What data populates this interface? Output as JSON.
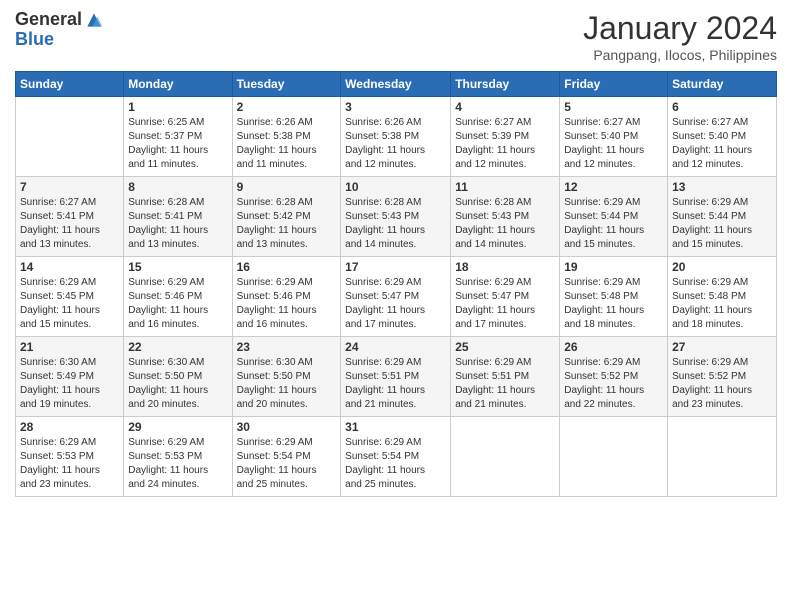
{
  "logo": {
    "general": "General",
    "blue": "Blue"
  },
  "title": "January 2024",
  "location": "Pangpang, Ilocos, Philippines",
  "days_header": [
    "Sunday",
    "Monday",
    "Tuesday",
    "Wednesday",
    "Thursday",
    "Friday",
    "Saturday"
  ],
  "weeks": [
    [
      {
        "day": "",
        "info": ""
      },
      {
        "day": "1",
        "info": "Sunrise: 6:25 AM\nSunset: 5:37 PM\nDaylight: 11 hours\nand 11 minutes."
      },
      {
        "day": "2",
        "info": "Sunrise: 6:26 AM\nSunset: 5:38 PM\nDaylight: 11 hours\nand 11 minutes."
      },
      {
        "day": "3",
        "info": "Sunrise: 6:26 AM\nSunset: 5:38 PM\nDaylight: 11 hours\nand 12 minutes."
      },
      {
        "day": "4",
        "info": "Sunrise: 6:27 AM\nSunset: 5:39 PM\nDaylight: 11 hours\nand 12 minutes."
      },
      {
        "day": "5",
        "info": "Sunrise: 6:27 AM\nSunset: 5:40 PM\nDaylight: 11 hours\nand 12 minutes."
      },
      {
        "day": "6",
        "info": "Sunrise: 6:27 AM\nSunset: 5:40 PM\nDaylight: 11 hours\nand 12 minutes."
      }
    ],
    [
      {
        "day": "7",
        "info": "Sunrise: 6:27 AM\nSunset: 5:41 PM\nDaylight: 11 hours\nand 13 minutes."
      },
      {
        "day": "8",
        "info": "Sunrise: 6:28 AM\nSunset: 5:41 PM\nDaylight: 11 hours\nand 13 minutes."
      },
      {
        "day": "9",
        "info": "Sunrise: 6:28 AM\nSunset: 5:42 PM\nDaylight: 11 hours\nand 13 minutes."
      },
      {
        "day": "10",
        "info": "Sunrise: 6:28 AM\nSunset: 5:43 PM\nDaylight: 11 hours\nand 14 minutes."
      },
      {
        "day": "11",
        "info": "Sunrise: 6:28 AM\nSunset: 5:43 PM\nDaylight: 11 hours\nand 14 minutes."
      },
      {
        "day": "12",
        "info": "Sunrise: 6:29 AM\nSunset: 5:44 PM\nDaylight: 11 hours\nand 15 minutes."
      },
      {
        "day": "13",
        "info": "Sunrise: 6:29 AM\nSunset: 5:44 PM\nDaylight: 11 hours\nand 15 minutes."
      }
    ],
    [
      {
        "day": "14",
        "info": "Sunrise: 6:29 AM\nSunset: 5:45 PM\nDaylight: 11 hours\nand 15 minutes."
      },
      {
        "day": "15",
        "info": "Sunrise: 6:29 AM\nSunset: 5:46 PM\nDaylight: 11 hours\nand 16 minutes."
      },
      {
        "day": "16",
        "info": "Sunrise: 6:29 AM\nSunset: 5:46 PM\nDaylight: 11 hours\nand 16 minutes."
      },
      {
        "day": "17",
        "info": "Sunrise: 6:29 AM\nSunset: 5:47 PM\nDaylight: 11 hours\nand 17 minutes."
      },
      {
        "day": "18",
        "info": "Sunrise: 6:29 AM\nSunset: 5:47 PM\nDaylight: 11 hours\nand 17 minutes."
      },
      {
        "day": "19",
        "info": "Sunrise: 6:29 AM\nSunset: 5:48 PM\nDaylight: 11 hours\nand 18 minutes."
      },
      {
        "day": "20",
        "info": "Sunrise: 6:29 AM\nSunset: 5:48 PM\nDaylight: 11 hours\nand 18 minutes."
      }
    ],
    [
      {
        "day": "21",
        "info": "Sunrise: 6:30 AM\nSunset: 5:49 PM\nDaylight: 11 hours\nand 19 minutes."
      },
      {
        "day": "22",
        "info": "Sunrise: 6:30 AM\nSunset: 5:50 PM\nDaylight: 11 hours\nand 20 minutes."
      },
      {
        "day": "23",
        "info": "Sunrise: 6:30 AM\nSunset: 5:50 PM\nDaylight: 11 hours\nand 20 minutes."
      },
      {
        "day": "24",
        "info": "Sunrise: 6:29 AM\nSunset: 5:51 PM\nDaylight: 11 hours\nand 21 minutes."
      },
      {
        "day": "25",
        "info": "Sunrise: 6:29 AM\nSunset: 5:51 PM\nDaylight: 11 hours\nand 21 minutes."
      },
      {
        "day": "26",
        "info": "Sunrise: 6:29 AM\nSunset: 5:52 PM\nDaylight: 11 hours\nand 22 minutes."
      },
      {
        "day": "27",
        "info": "Sunrise: 6:29 AM\nSunset: 5:52 PM\nDaylight: 11 hours\nand 23 minutes."
      }
    ],
    [
      {
        "day": "28",
        "info": "Sunrise: 6:29 AM\nSunset: 5:53 PM\nDaylight: 11 hours\nand 23 minutes."
      },
      {
        "day": "29",
        "info": "Sunrise: 6:29 AM\nSunset: 5:53 PM\nDaylight: 11 hours\nand 24 minutes."
      },
      {
        "day": "30",
        "info": "Sunrise: 6:29 AM\nSunset: 5:54 PM\nDaylight: 11 hours\nand 25 minutes."
      },
      {
        "day": "31",
        "info": "Sunrise: 6:29 AM\nSunset: 5:54 PM\nDaylight: 11 hours\nand 25 minutes."
      },
      {
        "day": "",
        "info": ""
      },
      {
        "day": "",
        "info": ""
      },
      {
        "day": "",
        "info": ""
      }
    ]
  ]
}
